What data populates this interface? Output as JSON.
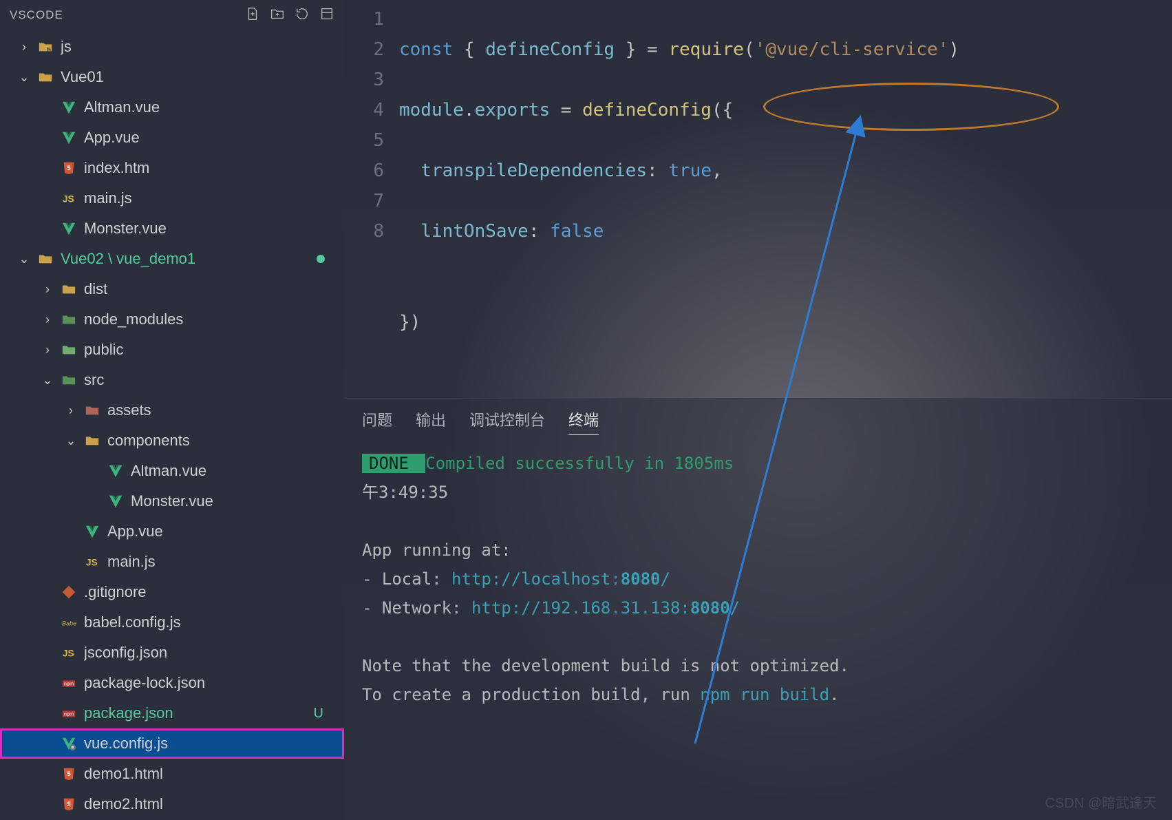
{
  "header": {
    "title": "VSCODE"
  },
  "tree": {
    "items": [
      {
        "depth": 0,
        "tw": "›",
        "icon": "js-folder",
        "label": "js",
        "cls": ""
      },
      {
        "depth": 0,
        "tw": "⌄",
        "icon": "folder-open",
        "label": "Vue01",
        "cls": ""
      },
      {
        "depth": 1,
        "tw": "",
        "icon": "vue",
        "label": "Altman.vue",
        "cls": ""
      },
      {
        "depth": 1,
        "tw": "",
        "icon": "vue",
        "label": "App.vue",
        "cls": ""
      },
      {
        "depth": 1,
        "tw": "",
        "icon": "html",
        "label": "index.htm",
        "cls": ""
      },
      {
        "depth": 1,
        "tw": "",
        "icon": "js",
        "label": "main.js",
        "cls": ""
      },
      {
        "depth": 1,
        "tw": "",
        "icon": "vue",
        "label": "Monster.vue",
        "cls": ""
      },
      {
        "depth": 0,
        "tw": "⌄",
        "icon": "folder-open-g",
        "label": "Vue02 \\ vue_demo1",
        "cls": "green",
        "dot": true
      },
      {
        "depth": 1,
        "tw": "›",
        "icon": "dist",
        "label": "dist",
        "cls": ""
      },
      {
        "depth": 1,
        "tw": "›",
        "icon": "nodemod",
        "label": "node_modules",
        "cls": ""
      },
      {
        "depth": 1,
        "tw": "›",
        "icon": "public",
        "label": "public",
        "cls": ""
      },
      {
        "depth": 1,
        "tw": "⌄",
        "icon": "src",
        "label": "src",
        "cls": ""
      },
      {
        "depth": 2,
        "tw": "›",
        "icon": "assets",
        "label": "assets",
        "cls": ""
      },
      {
        "depth": 2,
        "tw": "⌄",
        "icon": "comp",
        "label": "components",
        "cls": ""
      },
      {
        "depth": 3,
        "tw": "",
        "icon": "vue",
        "label": "Altman.vue",
        "cls": ""
      },
      {
        "depth": 3,
        "tw": "",
        "icon": "vue",
        "label": "Monster.vue",
        "cls": ""
      },
      {
        "depth": 2,
        "tw": "",
        "icon": "vue",
        "label": "App.vue",
        "cls": ""
      },
      {
        "depth": 2,
        "tw": "",
        "icon": "js",
        "label": "main.js",
        "cls": ""
      },
      {
        "depth": 1,
        "tw": "",
        "icon": "git",
        "label": ".gitignore",
        "cls": ""
      },
      {
        "depth": 1,
        "tw": "",
        "icon": "babel",
        "label": "babel.config.js",
        "cls": ""
      },
      {
        "depth": 1,
        "tw": "",
        "icon": "js",
        "label": "jsconfig.json",
        "cls": ""
      },
      {
        "depth": 1,
        "tw": "",
        "icon": "npm",
        "label": "package-lock.json",
        "cls": ""
      },
      {
        "depth": 1,
        "tw": "",
        "icon": "npm",
        "label": "package.json",
        "cls": "green",
        "badge": "U"
      },
      {
        "depth": 1,
        "tw": "",
        "icon": "vueconf",
        "label": "vue.config.js",
        "cls": "",
        "selected": true
      },
      {
        "depth": 1,
        "tw": "",
        "icon": "html",
        "label": "demo1.html",
        "cls": ""
      },
      {
        "depth": 1,
        "tw": "",
        "icon": "html",
        "label": "demo2.html",
        "cls": ""
      }
    ]
  },
  "editor": {
    "lines": [
      "1",
      "2",
      "3",
      "4",
      "5",
      "6",
      "7",
      "8"
    ],
    "code": {
      "l1": {
        "a": "const",
        "b": " { ",
        "c": "defineConfig",
        "d": " } = ",
        "e": "require",
        "f": "(",
        "g": "'@vue/cli-service'",
        "h": ")"
      },
      "l2": {
        "a": "module",
        "b": ".",
        "c": "exports",
        "d": " = ",
        "e": "defineConfig",
        "f": "({"
      },
      "l3": {
        "a": "  transpileDependencies",
        "b": ": ",
        "c": "true",
        "d": ","
      },
      "l4": {
        "a": "  lintOnSave",
        "b": ": ",
        "c": "false"
      },
      "l5": "",
      "l6": "})"
    }
  },
  "panel": {
    "tabs": [
      "问题",
      "输出",
      "调试控制台",
      "终端"
    ],
    "activeTab": 3
  },
  "terminal": {
    "done": " DONE ",
    "doneMsg": " Compiled successfully in 1805ms",
    "time": "午3:49:35",
    "appRunning": "  App running at:",
    "localLabel": "  - Local:   ",
    "localUrl1": "http://localhost:",
    "localPort": "8080",
    "localUrl2": "/",
    "netLabel": "  - Network: ",
    "netUrl1": "http://192.168.31.138:",
    "netPort": "8080",
    "netUrl2": "/",
    "note1": "  Note that the development build is not optimized.",
    "note2a": "  To create a production build, run ",
    "note2b": "npm run build",
    "note2c": "."
  },
  "watermark": "CSDN @暗武逢天"
}
